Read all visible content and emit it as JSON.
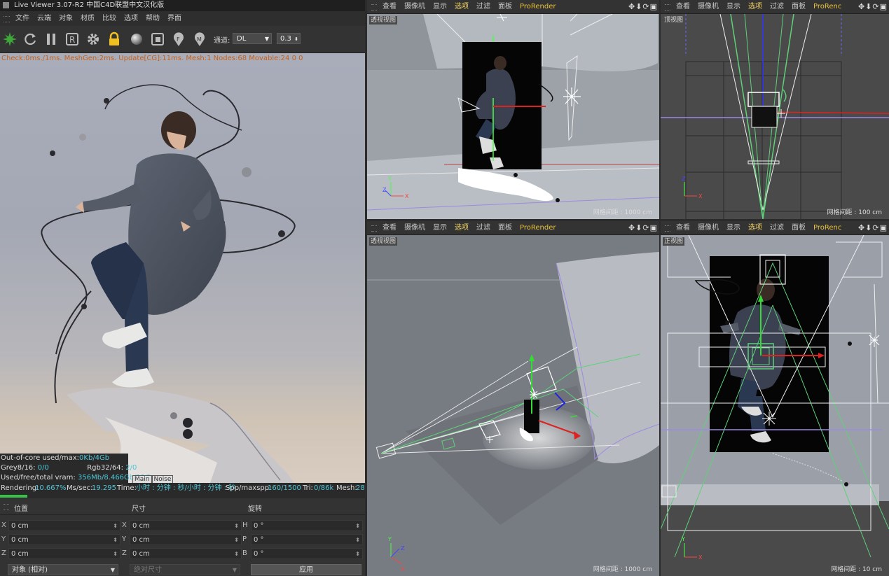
{
  "app": {
    "title": "Live Viewer 3.07-R2 中国C4D联盟中文汉化版"
  },
  "live_viewer": {
    "menu": [
      "文件",
      "云端",
      "对象",
      "材质",
      "比较",
      "选项",
      "帮助",
      "界面"
    ],
    "toolbar": {
      "channel_label": "通道:",
      "channel_value": "DL",
      "value": "0.3"
    },
    "stats_line": "Check:0ms./1ms. MeshGen:2ms. Update[CG]:11ms. Mesh:1 Nodes:68 Movable:24  0 0",
    "info": {
      "row1_label": "Out-of-core used/max:",
      "row1_value": "0Kb/4Gb",
      "row2_label1": "Grey8/16:",
      "row2_value1": "0/0",
      "row2_label2": "Rgb32/64:",
      "row2_value2": "2/0",
      "row3_label": "Used/free/total vram:",
      "row3_value": "356Mb/8.466Gb/11G"
    },
    "render_tabs": [
      "Main",
      "Noise"
    ],
    "status": {
      "rendering_label": "Rendering:",
      "rendering_value": "10.667%",
      "ms_label": "Ms/sec:",
      "ms_value": "19.295",
      "time_label": "Time:",
      "time_value": "小时 : 分钟 : 秒/小时 : 分钟 : 秒",
      "spp_label": "Spp/maxspp:",
      "spp_value": "160/1500",
      "tri_label": "Tri:",
      "tri_value": "0/86k",
      "mesh_label": "Mesh:",
      "mesh_value": "28"
    },
    "progress": 0.1067
  },
  "coords": {
    "headers": {
      "position": "位置",
      "size": "尺寸",
      "rotation": "旋转"
    },
    "rows": [
      {
        "pos_axis": "X",
        "pos": "0 cm",
        "size_axis": "X",
        "size": "0 cm",
        "rot_axis": "H",
        "rot": "0 °"
      },
      {
        "pos_axis": "Y",
        "pos": "0 cm",
        "size_axis": "Y",
        "size": "0 cm",
        "rot_axis": "P",
        "rot": "0 °"
      },
      {
        "pos_axis": "Z",
        "pos": "0 cm",
        "size_axis": "Z",
        "size": "0 cm",
        "rot_axis": "B",
        "rot": "0 °"
      }
    ],
    "mode": "对象 (相对)",
    "size_mode": "绝对尺寸",
    "apply": "应用"
  },
  "viewports": {
    "menu": [
      "查看",
      "摄像机",
      "显示",
      "选项",
      "过滤",
      "面板"
    ],
    "prorender": "ProRender",
    "prorender_short": "ProRenc",
    "nav_icons": [
      "move-icon",
      "zoom-icon",
      "rotate-icon",
      "maximize-icon"
    ],
    "tl": {
      "label": "透视视图",
      "grid": "网格间距 : 1000 cm"
    },
    "tr": {
      "label": "顶视图",
      "grid": "网格间距 : 100 cm"
    },
    "bl": {
      "label": "透视视图",
      "grid": "网格间距 : 1000 cm"
    },
    "br": {
      "label": "正视图",
      "grid": "网格间距 : 10 cm"
    }
  },
  "colors": {
    "accent": "#e8c23c",
    "stats": "#c6601a",
    "cyan": "#4fc6d8",
    "progress": "#38c24a"
  }
}
